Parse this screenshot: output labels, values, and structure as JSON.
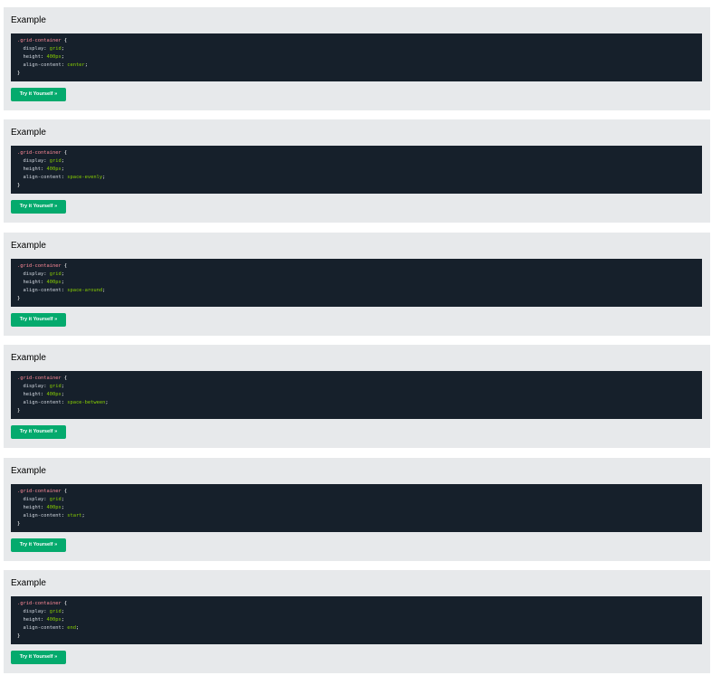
{
  "examples": [
    {
      "title": "Example",
      "code": {
        "selector": ".grid-container",
        "open_brace": " {",
        "declarations": [
          {
            "property": "display",
            "value": "grid"
          },
          {
            "property": "height",
            "value": "400px"
          },
          {
            "property": "align-content",
            "value": "center"
          }
        ],
        "close_brace": "}"
      },
      "button_label": "Try it Yourself »"
    },
    {
      "title": "Example",
      "code": {
        "selector": ".grid-container",
        "open_brace": " {",
        "declarations": [
          {
            "property": "display",
            "value": "grid"
          },
          {
            "property": "height",
            "value": "400px"
          },
          {
            "property": "align-content",
            "value": "space-evenly"
          }
        ],
        "close_brace": "}"
      },
      "button_label": "Try it Yourself »"
    },
    {
      "title": "Example",
      "code": {
        "selector": ".grid-container",
        "open_brace": " {",
        "declarations": [
          {
            "property": "display",
            "value": "grid"
          },
          {
            "property": "height",
            "value": "400px"
          },
          {
            "property": "align-content",
            "value": "space-around"
          }
        ],
        "close_brace": "}"
      },
      "button_label": "Try it Yourself »"
    },
    {
      "title": "Example",
      "code": {
        "selector": ".grid-container",
        "open_brace": " {",
        "declarations": [
          {
            "property": "display",
            "value": "grid"
          },
          {
            "property": "height",
            "value": "400px"
          },
          {
            "property": "align-content",
            "value": "space-between"
          }
        ],
        "close_brace": "}"
      },
      "button_label": "Try it Yourself »"
    },
    {
      "title": "Example",
      "code": {
        "selector": ".grid-container",
        "open_brace": " {",
        "declarations": [
          {
            "property": "display",
            "value": "grid"
          },
          {
            "property": "height",
            "value": "400px"
          },
          {
            "property": "align-content",
            "value": "start"
          }
        ],
        "close_brace": "}"
      },
      "button_label": "Try it Yourself »"
    },
    {
      "title": "Example",
      "code": {
        "selector": ".grid-container",
        "open_brace": " {",
        "declarations": [
          {
            "property": "display",
            "value": "grid"
          },
          {
            "property": "height",
            "value": "400px"
          },
          {
            "property": "align-content",
            "value": "end"
          }
        ],
        "close_brace": "}"
      },
      "button_label": "Try it Yourself »"
    }
  ],
  "colors": {
    "panel_background": "#e7e9eb",
    "code_background": "#16202b",
    "selector_color": "#ff8a98",
    "value_color": "#88ce02",
    "button_color": "#04aa6d"
  }
}
